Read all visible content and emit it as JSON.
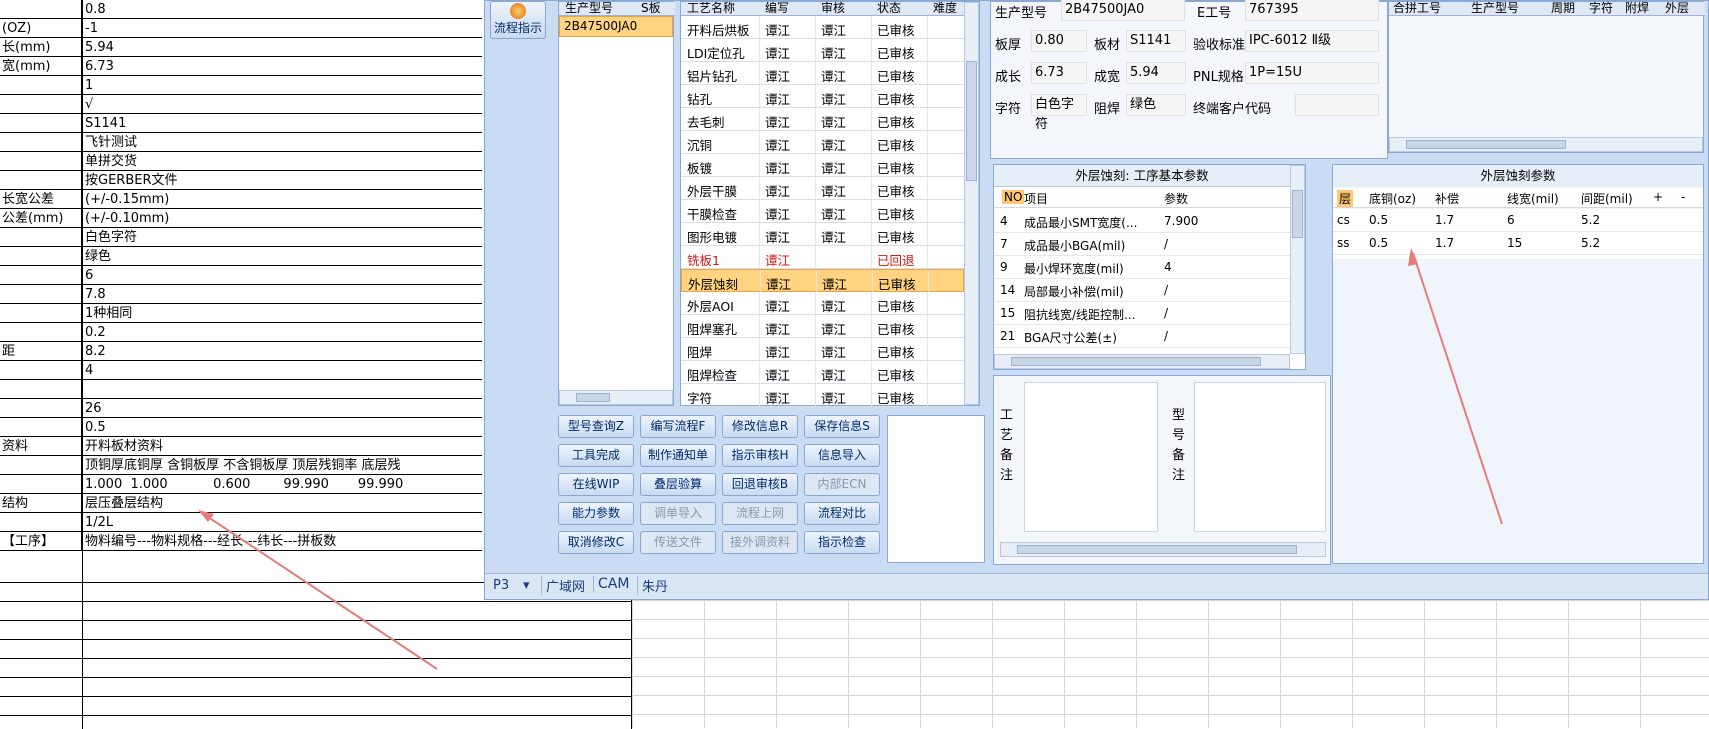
{
  "sheet": {
    "rows": [
      {
        "k": "",
        "v": "0.8"
      },
      {
        "k": "(OZ)",
        "v": "-1"
      },
      {
        "k": "长(mm)",
        "v": "5.94"
      },
      {
        "k": "宽(mm)",
        "v": "6.73"
      },
      {
        "k": "",
        "v": "1"
      },
      {
        "k": "",
        "v": "√"
      },
      {
        "k": "",
        "v": "S1141"
      },
      {
        "k": "",
        "v": "飞针测试"
      },
      {
        "k": "",
        "v": "单拼交货"
      },
      {
        "k": "",
        "v": "按GERBER文件"
      },
      {
        "k": "长宽公差",
        "v": "(+/-0.15mm)"
      },
      {
        "k": "公差(mm)",
        "v": "(+/-0.10mm)"
      },
      {
        "k": "",
        "v": "白色字符"
      },
      {
        "k": "",
        "v": "绿色"
      },
      {
        "k": "",
        "v": "6"
      },
      {
        "k": "",
        "v": "7.8"
      },
      {
        "k": "",
        "v": "1种相同"
      },
      {
        "k": "",
        "v": "0.2"
      },
      {
        "k": "距",
        "v": "8.2"
      },
      {
        "k": "",
        "v": "4"
      },
      {
        "k": "",
        "v": ""
      },
      {
        "k": "",
        "v": "26"
      },
      {
        "k": "",
        "v": "0.5"
      },
      {
        "k": "资料",
        "v": "开料板材资料"
      },
      {
        "k": "",
        "v": "顶铜厚底铜厚 含铜板厚 不含铜板厚 顶层残铜率 底层残"
      },
      {
        "k": "",
        "v": "1.000  1.000           0.600        99.990       99.990"
      },
      {
        "k": "结构",
        "v": "层压叠层结构"
      },
      {
        "k": "",
        "v": "1/2L"
      },
      {
        "k": "【工序】",
        "v": "物料编号---物料规格---经长---纬长---拼板数"
      }
    ]
  },
  "app": {
    "flow_button": "流程指示",
    "model_list": {
      "headers": [
        "生产型号",
        "S板"
      ],
      "items": [
        "2B47500JA0"
      ]
    },
    "process": {
      "headers": [
        "工艺名称",
        "编写",
        "审核",
        "状态",
        "难度"
      ],
      "rows": [
        {
          "name": "开料后烘板",
          "w": "谭江",
          "r": "谭江",
          "s": "已审核"
        },
        {
          "name": "LDI定位孔",
          "w": "谭江",
          "r": "谭江",
          "s": "已审核"
        },
        {
          "name": "铝片钻孔",
          "w": "谭江",
          "r": "谭江",
          "s": "已审核"
        },
        {
          "name": "钻孔",
          "w": "谭江",
          "r": "谭江",
          "s": "已审核"
        },
        {
          "name": "去毛刺",
          "w": "谭江",
          "r": "谭江",
          "s": "已审核"
        },
        {
          "name": "沉铜",
          "w": "谭江",
          "r": "谭江",
          "s": "已审核"
        },
        {
          "name": "板镀",
          "w": "谭江",
          "r": "谭江",
          "s": "已审核"
        },
        {
          "name": "外层干膜",
          "w": "谭江",
          "r": "谭江",
          "s": "已审核"
        },
        {
          "name": "干膜检查",
          "w": "谭江",
          "r": "谭江",
          "s": "已审核"
        },
        {
          "name": "图形电镀",
          "w": "谭江",
          "r": "谭江",
          "s": "已审核"
        },
        {
          "name": "铣板1",
          "w": "谭江",
          "r": "",
          "s": "已回退"
        },
        {
          "name": "外层蚀刻",
          "w": "谭江",
          "r": "谭江",
          "s": "已审核"
        },
        {
          "name": "外层AOI",
          "w": "谭江",
          "r": "谭江",
          "s": "已审核"
        },
        {
          "name": "阻焊塞孔",
          "w": "谭江",
          "r": "谭江",
          "s": "已审核"
        },
        {
          "name": "阻焊",
          "w": "谭江",
          "r": "谭江",
          "s": "已审核"
        },
        {
          "name": "阻焊检查",
          "w": "谭江",
          "r": "谭江",
          "s": "已审核"
        },
        {
          "name": "字符",
          "w": "谭江",
          "r": "谭江",
          "s": "已审核"
        }
      ]
    },
    "buttons": [
      [
        "型号查询Z",
        "编写流程F",
        "修改信息R",
        "保存信息S"
      ],
      [
        "工具完成",
        "制作通知单",
        "指示审核H",
        "信息导入"
      ],
      [
        "在线WIP",
        "叠层验算",
        "回退审核B",
        "内部ECN"
      ],
      [
        "能力参数",
        "调单导入",
        "流程上网",
        "流程对比"
      ],
      [
        "取消修改C",
        "传送文件",
        "接外调资料",
        "指示检查"
      ]
    ],
    "info": {
      "prod_label": "生产型号",
      "prod": "2B47500JA0",
      "eno_label": "E工号",
      "eno": "767395",
      "thick_label": "板厚",
      "thick": "0.80",
      "mat_label": "板材",
      "mat": "S1141",
      "std_label": "验收标准",
      "std": "IPC-6012 Ⅱ级",
      "len_label": "成长",
      "len": "6.73",
      "wid_label": "成宽",
      "wid": "5.94",
      "pnl_label": "PNL规格",
      "pnl": "1P=15U",
      "char_label": "字符",
      "char": "白色字符",
      "mask_label": "阻焊",
      "mask": "绿色",
      "cust_label": "终端客户代码",
      "cust": ""
    },
    "merge_headers": [
      "合拼工号",
      "生产型号",
      "周期",
      "字符",
      "附焊",
      "外层"
    ],
    "etch_basic": {
      "title": "外层蚀刻: 工序基本参数",
      "headers": [
        "NO",
        "项目",
        "参数"
      ],
      "rows": [
        {
          "no": "4",
          "item": "成品最小SMT宽度(...",
          "val": "7.900"
        },
        {
          "no": "7",
          "item": "成品最小BGA(mil)",
          "val": "/"
        },
        {
          "no": "9",
          "item": "最小焊环宽度(mil)",
          "val": "4"
        },
        {
          "no": "14",
          "item": "局部最小补偿(mil)",
          "val": "/"
        },
        {
          "no": "15",
          "item": "阻抗线宽/线距控制...",
          "val": "/"
        },
        {
          "no": "21",
          "item": "BGA尺寸公差(±)",
          "val": "/"
        }
      ]
    },
    "etch_params": {
      "title": "外层蚀刻参数",
      "headers": [
        "层",
        "底铜(oz)",
        "补偿",
        "线宽(mil)",
        "间距(mil)",
        "+",
        "-"
      ],
      "rows": [
        {
          "layer": "cs",
          "cu": "0.5",
          "comp": "1.7",
          "lw": "6",
          "sp": "5.2"
        },
        {
          "layer": "ss",
          "cu": "0.5",
          "comp": "1.7",
          "lw": "15",
          "sp": "5.2"
        }
      ]
    },
    "remark1": "工艺备注",
    "remark2": "型号备注",
    "status": {
      "p": "P3",
      "items": [
        "广域网",
        "CAM",
        "朱丹"
      ]
    }
  }
}
